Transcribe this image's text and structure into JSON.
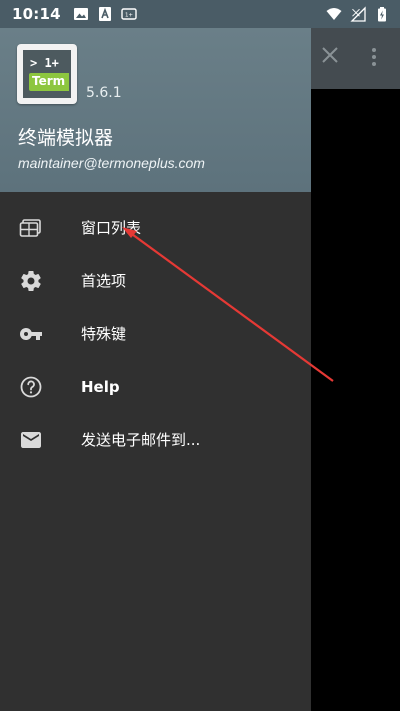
{
  "status_bar": {
    "time": "10:14",
    "left_icons": [
      "image-icon",
      "font-a-icon",
      "screen-notification-icon"
    ],
    "right_icons": [
      "wifi-icon",
      "no-signal-icon",
      "battery-charging-icon"
    ]
  },
  "toolbar": {
    "close_icon": "close-icon",
    "more_icon": "more-vert-icon"
  },
  "drawer": {
    "icon_text_top": "> 1+",
    "icon_text_bottom": "Term",
    "version": "5.6.1",
    "title": "终端模拟器",
    "email": "maintainer@termoneplus.com",
    "items": [
      {
        "label": "窗口列表",
        "icon": "window-list-icon",
        "bold": false
      },
      {
        "label": "首选项",
        "icon": "gear-icon",
        "bold": false
      },
      {
        "label": "特殊键",
        "icon": "key-icon",
        "bold": false
      },
      {
        "label": "Help",
        "icon": "help-icon",
        "bold": true
      },
      {
        "label": "发送电子邮件到...",
        "icon": "email-icon",
        "bold": false
      }
    ]
  },
  "colors": {
    "status_bar": "#4a5c66",
    "drawer_header": "#6a7f88",
    "drawer_bg": "#303030",
    "annotation_arrow": "#e53935",
    "icon_green": "#8dc63f"
  }
}
